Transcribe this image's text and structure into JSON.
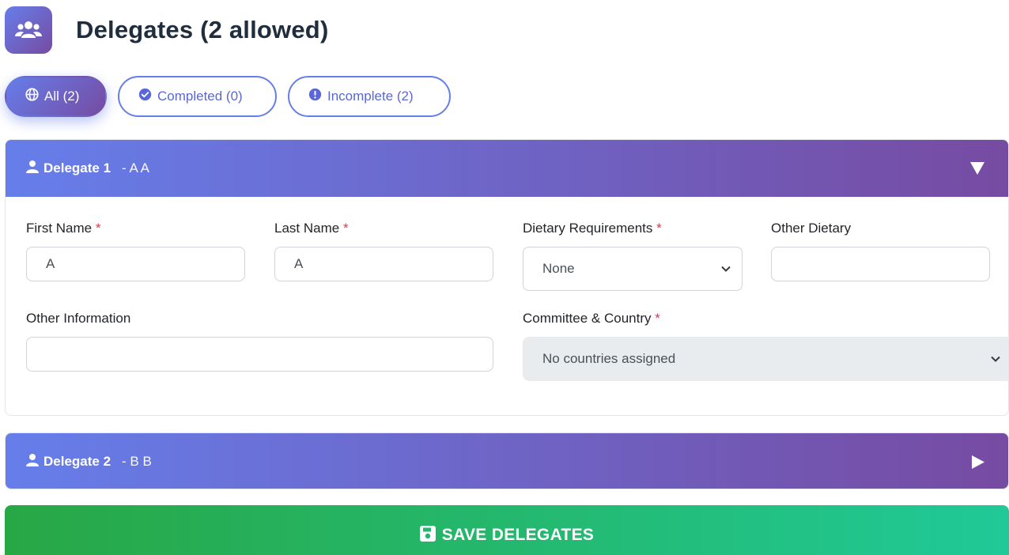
{
  "header": {
    "title": "Delegates (2 allowed)",
    "icon": "users-icon"
  },
  "filters": [
    {
      "label": "All (2)",
      "icon": "globe-icon",
      "active": true
    },
    {
      "label": "Completed (0)",
      "icon": "check-circle-icon",
      "active": false
    },
    {
      "label": "Incomplete (2)",
      "icon": "exclamation-circle-icon",
      "active": false
    }
  ],
  "delegates": [
    {
      "title": "Delegate 1",
      "subtitle": "- A A",
      "expanded": true,
      "fields": {
        "first_name_label": "First Name",
        "first_name_value": "A",
        "last_name_label": "Last Name",
        "last_name_value": "A",
        "dietary_label": "Dietary Requirements",
        "dietary_value": "None",
        "other_dietary_label": "Other Dietary",
        "other_dietary_value": "",
        "other_info_label": "Other Information",
        "other_info_value": "",
        "committee_label": "Committee & Country",
        "committee_value": "No countries assigned"
      }
    },
    {
      "title": "Delegate 2",
      "subtitle": "- B B",
      "expanded": false
    }
  ],
  "required_marker": "*",
  "save_button": {
    "label": "SAVE DELEGATES",
    "icon": "floppy-disk-icon"
  },
  "colors": {
    "accent": "#667eea",
    "accent_end": "#764ba2",
    "save_start": "#28a745",
    "save_end": "#20c997",
    "required": "#dc3545"
  }
}
